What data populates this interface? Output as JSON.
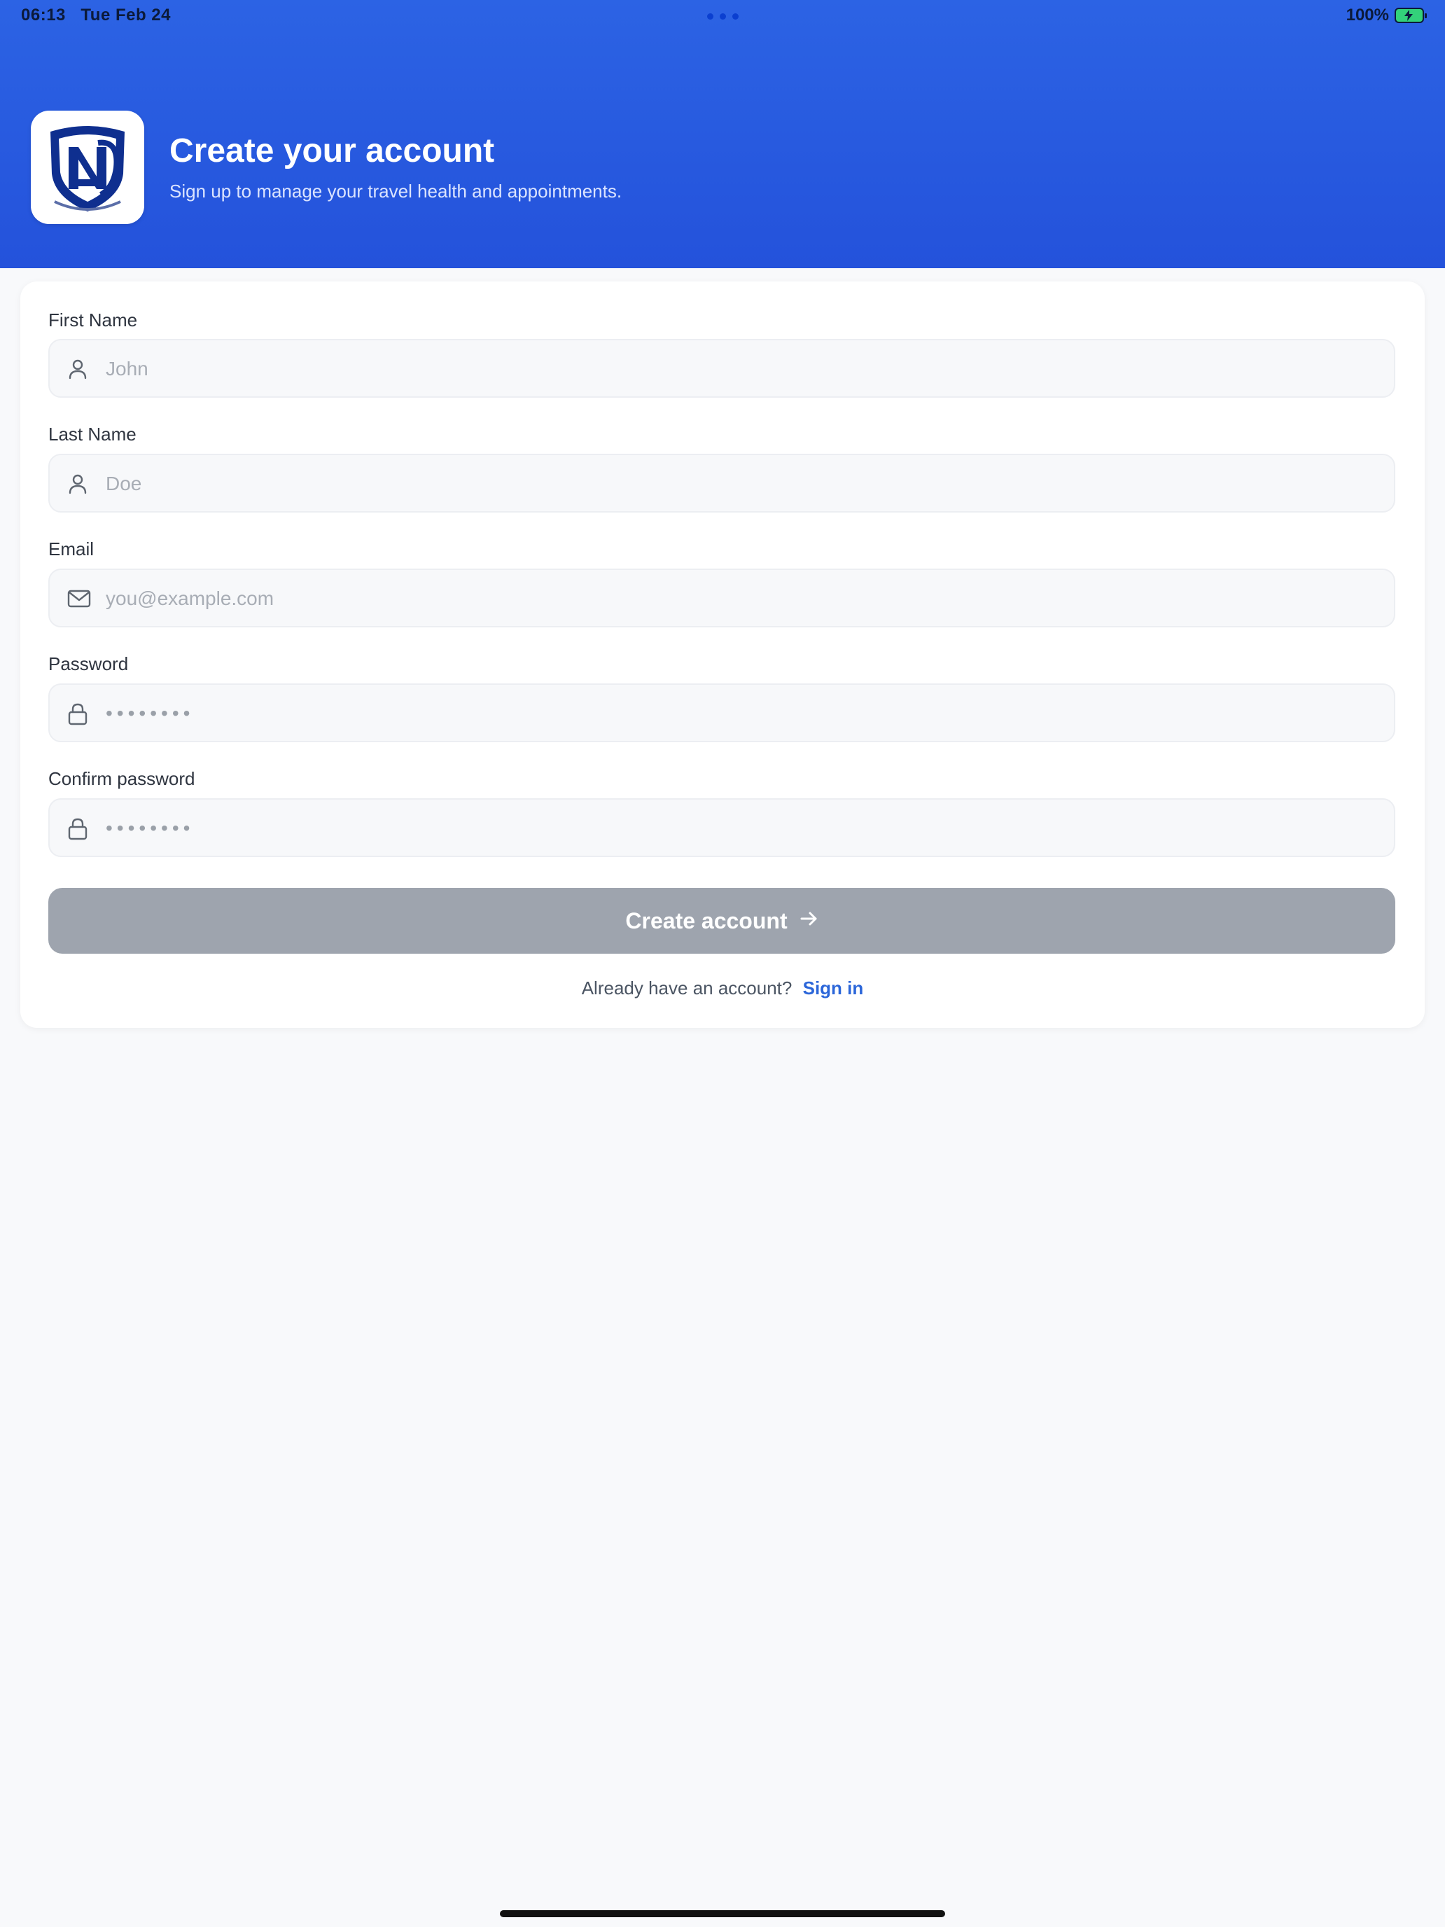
{
  "status_bar": {
    "time": "06:13",
    "date": "Tue Feb 24",
    "battery_percent": "100%",
    "battery_level": 1.0,
    "battery_charging": true
  },
  "header": {
    "title": "Create your account",
    "subtitle": "Sign up to manage your travel health and appointments.",
    "accent_color": "#2858df"
  },
  "form": {
    "first_name": {
      "label": "First Name",
      "placeholder": "John",
      "value": ""
    },
    "last_name": {
      "label": "Last Name",
      "placeholder": "Doe",
      "value": ""
    },
    "email": {
      "label": "Email",
      "placeholder": "you@example.com",
      "value": ""
    },
    "password": {
      "label": "Password",
      "placeholder": "••••••••",
      "value": ""
    },
    "confirm_password": {
      "label": "Confirm password",
      "placeholder": "••••••••",
      "value": ""
    },
    "submit_label": "Create account",
    "submit_enabled": false,
    "signin_prompt": "Already have an account?",
    "signin_link": "Sign in"
  },
  "icons": {
    "name_fields": "person-icon",
    "email_field": "mail-icon",
    "password_fields": "lock-icon",
    "submit": "arrow-right-icon"
  }
}
